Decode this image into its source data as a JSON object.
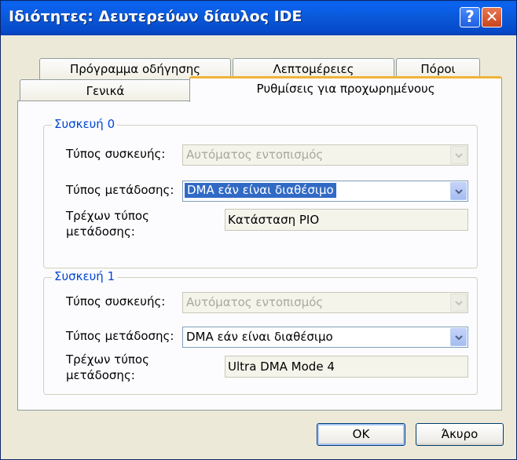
{
  "window": {
    "title": "Ιδιότητες: Δευτερεύων δίαυλος IDE",
    "help_glyph": "?",
    "close_glyph": "✕"
  },
  "tabs": {
    "row1": [
      "Πρόγραμμα οδήγησης",
      "Λεπτομέρειες",
      "Πόροι"
    ],
    "row2": [
      "Γενικά",
      "Ρυθμίσεις για προχωρημένους"
    ],
    "active": "Ρυθμίσεις για προχωρημένους"
  },
  "device0": {
    "legend": "Συσκευή 0",
    "device_type_label": "Τύπος συσκευής:",
    "device_type_value": "Αυτόματος εντοπισμός",
    "transfer_mode_label": "Τύπος μετάδοσης:",
    "transfer_mode_value": "DMA εάν είναι διαθέσιμο",
    "current_mode_label_1": "Τρέχων τύπος",
    "current_mode_label_2": "μετάδοσης:",
    "current_mode_value": "Κατάσταση PIO"
  },
  "device1": {
    "legend": "Συσκευή 1",
    "device_type_label": "Τύπος συσκευής:",
    "device_type_value": "Αυτόματος εντοπισμός",
    "transfer_mode_label": "Τύπος μετάδοσης:",
    "transfer_mode_value": "DMA εάν είναι διαθέσιμο",
    "current_mode_label_1": "Τρέχων τύπος",
    "current_mode_label_2": "μετάδοσης:",
    "current_mode_value": "Ultra DMA Mode 4"
  },
  "buttons": {
    "ok": "OK",
    "cancel": "Άκυρο"
  },
  "colors": {
    "titlebar": "#0a58d8",
    "selection": "#316ac5",
    "group_legend": "#0046d5",
    "active_tab_accent": "#f0b43a"
  }
}
